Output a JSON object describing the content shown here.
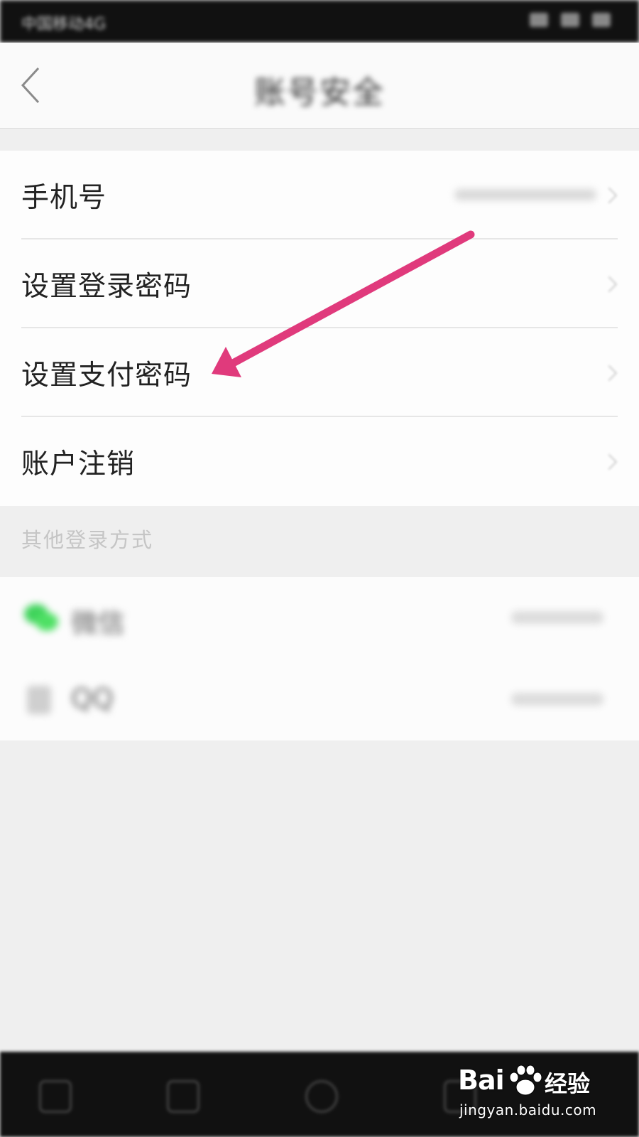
{
  "status_bar": {
    "carrier": "中国移动4G"
  },
  "nav": {
    "title": "账号安全",
    "back_icon": "chevron-left-icon"
  },
  "settings": {
    "items": [
      {
        "label": "手机号"
      },
      {
        "label": "设置登录密码"
      },
      {
        "label": "设置支付密码"
      },
      {
        "label": "账户注销"
      }
    ]
  },
  "other_login": {
    "header": "其他登录方式",
    "items": [
      {
        "label": "微信",
        "icon": "wechat-icon"
      },
      {
        "label": "QQ",
        "icon": "qq-icon"
      }
    ]
  },
  "annotation": {
    "color": "#e03a7c",
    "points_to": "设置支付密码"
  },
  "watermark": {
    "brand": "Bai",
    "brand_suffix": "经验",
    "url": "jingyan.baidu.com"
  }
}
